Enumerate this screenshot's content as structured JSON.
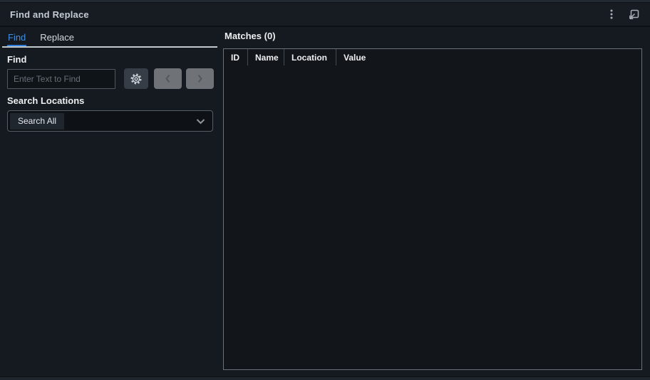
{
  "window": {
    "title": "Find and Replace"
  },
  "titlebar": {
    "more_options_icon": "more-vertical-icon",
    "popout_icon": "pop-out-icon"
  },
  "tabs": [
    {
      "label": "Find",
      "active": true
    },
    {
      "label": "Replace",
      "active": false
    }
  ],
  "find_section": {
    "label": "Find",
    "input_value": "",
    "input_placeholder": "Enter Text to Find",
    "settings_icon": "gear-icon",
    "prev_icon": "chevron-left-icon",
    "next_icon": "chevron-right-icon"
  },
  "search_locations": {
    "label": "Search Locations",
    "selected": "Search All",
    "chevron_icon": "chevron-down-icon"
  },
  "matches": {
    "title": "Matches (0)",
    "count": 0,
    "columns": [
      "ID",
      "Name",
      "Location",
      "Value"
    ],
    "rows": []
  },
  "colors": {
    "background": "#151a20",
    "titlebar_background": "#171c23",
    "accent_blue": "#3f8ee0",
    "tab_underline": "#2f7ed8",
    "panel_underline": "#c3c8cd",
    "table_border": "#6b717a",
    "disabled_button": "#6f7378",
    "gear_button": "#363d47"
  }
}
